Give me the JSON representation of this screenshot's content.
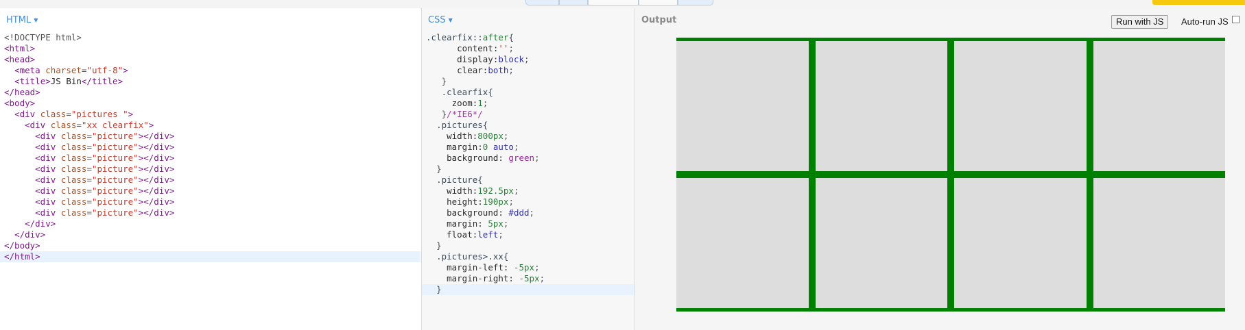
{
  "topbar": {
    "tabs": [
      "",
      "",
      "",
      "",
      ""
    ],
    "cta_label": ""
  },
  "html_panel": {
    "label": "HTML",
    "caret_icon": "caret-down-icon"
  },
  "css_panel": {
    "label": "CSS",
    "caret_icon": "caret-down-icon"
  },
  "output_panel": {
    "label": "Output",
    "run_button_label": "Run with JS",
    "autorun_label": "Auto-run JS",
    "autorun_checked": false
  },
  "html_code": [
    [
      [
        "punct",
        "<!DOCTYPE html>"
      ]
    ],
    [
      [
        "tag",
        "<html>"
      ]
    ],
    [
      [
        "tag",
        "<head>"
      ]
    ],
    [
      [
        "txt",
        "  "
      ],
      [
        "tag",
        "<meta "
      ],
      [
        "attr",
        "charset"
      ],
      [
        "punct",
        "="
      ],
      [
        "str",
        "\"utf-8\""
      ],
      [
        "tag",
        ">"
      ]
    ],
    [
      [
        "txt",
        "  "
      ],
      [
        "tag",
        "<title>"
      ],
      [
        "txt",
        "JS Bin"
      ],
      [
        "tag",
        "</title>"
      ]
    ],
    [
      [
        "tag",
        "</head>"
      ]
    ],
    [
      [
        "tag",
        "<body>"
      ]
    ],
    [
      [
        "txt",
        "  "
      ],
      [
        "tag",
        "<div "
      ],
      [
        "attr",
        "class"
      ],
      [
        "punct",
        "="
      ],
      [
        "str",
        "\"pictures \""
      ],
      [
        "tag",
        ">"
      ]
    ],
    [
      [
        "txt",
        "    "
      ],
      [
        "tag",
        "<div "
      ],
      [
        "attr",
        "class"
      ],
      [
        "punct",
        "="
      ],
      [
        "str",
        "\"xx clearfix\""
      ],
      [
        "tag",
        ">"
      ]
    ],
    [
      [
        "txt",
        "      "
      ],
      [
        "tag",
        "<div "
      ],
      [
        "attr",
        "class"
      ],
      [
        "punct",
        "="
      ],
      [
        "str",
        "\"picture\""
      ],
      [
        "tag",
        "></div>"
      ]
    ],
    [
      [
        "txt",
        "      "
      ],
      [
        "tag",
        "<div "
      ],
      [
        "attr",
        "class"
      ],
      [
        "punct",
        "="
      ],
      [
        "str",
        "\"picture\""
      ],
      [
        "tag",
        "></div>"
      ]
    ],
    [
      [
        "txt",
        "      "
      ],
      [
        "tag",
        "<div "
      ],
      [
        "attr",
        "class"
      ],
      [
        "punct",
        "="
      ],
      [
        "str",
        "\"picture\""
      ],
      [
        "tag",
        "></div>"
      ]
    ],
    [
      [
        "txt",
        "      "
      ],
      [
        "tag",
        "<div "
      ],
      [
        "attr",
        "class"
      ],
      [
        "punct",
        "="
      ],
      [
        "str",
        "\"picture\""
      ],
      [
        "tag",
        "></div>"
      ]
    ],
    [
      [
        "txt",
        "      "
      ],
      [
        "tag",
        "<div "
      ],
      [
        "attr",
        "class"
      ],
      [
        "punct",
        "="
      ],
      [
        "str",
        "\"picture\""
      ],
      [
        "tag",
        "></div>"
      ]
    ],
    [
      [
        "txt",
        "      "
      ],
      [
        "tag",
        "<div "
      ],
      [
        "attr",
        "class"
      ],
      [
        "punct",
        "="
      ],
      [
        "str",
        "\"picture\""
      ],
      [
        "tag",
        "></div>"
      ]
    ],
    [
      [
        "txt",
        "      "
      ],
      [
        "tag",
        "<div "
      ],
      [
        "attr",
        "class"
      ],
      [
        "punct",
        "="
      ],
      [
        "str",
        "\"picture\""
      ],
      [
        "tag",
        "></div>"
      ]
    ],
    [
      [
        "txt",
        "      "
      ],
      [
        "tag",
        "<div "
      ],
      [
        "attr",
        "class"
      ],
      [
        "punct",
        "="
      ],
      [
        "str",
        "\"picture\""
      ],
      [
        "tag",
        "></div>"
      ]
    ],
    [
      [
        "txt",
        "    "
      ],
      [
        "tag",
        "</div>"
      ]
    ],
    [
      [
        "txt",
        "  "
      ],
      [
        "tag",
        "</div>"
      ]
    ],
    [
      [
        "tag",
        "</body>"
      ]
    ],
    [
      [
        "tag",
        "</html>"
      ]
    ]
  ],
  "html_highlight_line": 20,
  "css_code": [
    [
      [
        "sel",
        ".clearfix::"
      ],
      [
        "val",
        "after"
      ],
      [
        "sel",
        "{"
      ]
    ],
    [
      [
        "txt",
        "      "
      ],
      [
        "prop",
        "content:"
      ],
      [
        "str",
        "''"
      ],
      [
        "punct",
        ";"
      ]
    ],
    [
      [
        "txt",
        "      "
      ],
      [
        "prop",
        "display:"
      ],
      [
        "kw",
        "block"
      ],
      [
        "punct",
        ";"
      ]
    ],
    [
      [
        "txt",
        "      "
      ],
      [
        "prop",
        "clear:"
      ],
      [
        "kw",
        "both"
      ],
      [
        "punct",
        ";"
      ]
    ],
    [
      [
        "txt",
        "   "
      ],
      [
        "punct",
        "}"
      ]
    ],
    [
      [
        "txt",
        "   "
      ],
      [
        "sel",
        ".clearfix{"
      ]
    ],
    [
      [
        "txt",
        "     "
      ],
      [
        "prop",
        "zoom:"
      ],
      [
        "val",
        "1"
      ],
      [
        "punct",
        ";"
      ]
    ],
    [
      [
        "txt",
        "   "
      ],
      [
        "punct",
        "}"
      ],
      [
        "cm",
        "/*IE6*/"
      ]
    ],
    [
      [
        "txt",
        "  "
      ],
      [
        "sel",
        ".pictures{"
      ]
    ],
    [
      [
        "txt",
        "    "
      ],
      [
        "prop",
        "width:"
      ],
      [
        "val",
        "800px"
      ],
      [
        "punct",
        ";"
      ]
    ],
    [
      [
        "txt",
        "    "
      ],
      [
        "prop",
        "margin:"
      ],
      [
        "val",
        "0 "
      ],
      [
        "kw",
        "auto"
      ],
      [
        "punct",
        ";"
      ]
    ],
    [
      [
        "txt",
        "    "
      ],
      [
        "prop",
        "background: "
      ],
      [
        "col",
        "green"
      ],
      [
        "punct",
        ";"
      ]
    ],
    [
      [
        "txt",
        "  "
      ],
      [
        "punct",
        "}"
      ]
    ],
    [
      [
        "txt",
        "  "
      ],
      [
        "sel",
        ".picture{"
      ]
    ],
    [
      [
        "txt",
        "    "
      ],
      [
        "prop",
        "width:"
      ],
      [
        "val",
        "192.5px"
      ],
      [
        "punct",
        ";"
      ]
    ],
    [
      [
        "txt",
        "    "
      ],
      [
        "prop",
        "height:"
      ],
      [
        "val",
        "190px"
      ],
      [
        "punct",
        ";"
      ]
    ],
    [
      [
        "txt",
        "    "
      ],
      [
        "prop",
        "background: "
      ],
      [
        "kw",
        "#ddd"
      ],
      [
        "punct",
        ";"
      ]
    ],
    [
      [
        "txt",
        "    "
      ],
      [
        "prop",
        "margin: "
      ],
      [
        "val",
        "5px"
      ],
      [
        "punct",
        ";"
      ]
    ],
    [
      [
        "txt",
        "    "
      ],
      [
        "prop",
        "float:"
      ],
      [
        "kw",
        "left"
      ],
      [
        "punct",
        ";"
      ]
    ],
    [
      [
        "txt",
        "  "
      ],
      [
        "punct",
        "}"
      ]
    ],
    [
      [
        "txt",
        "  "
      ],
      [
        "sel",
        ".pictures>.xx{"
      ]
    ],
    [
      [
        "txt",
        "    "
      ],
      [
        "prop",
        "margin-left: "
      ],
      [
        "val",
        "-5px"
      ],
      [
        "punct",
        ";"
      ]
    ],
    [
      [
        "txt",
        "    "
      ],
      [
        "prop",
        "margin-right: "
      ],
      [
        "val",
        "-5px"
      ],
      [
        "punct",
        ";"
      ]
    ],
    [
      [
        "txt",
        "  "
      ],
      [
        "punct",
        "}"
      ]
    ]
  ],
  "css_highlight_line": 23,
  "output": {
    "container_color": "#008000",
    "picture_color": "#dddddd",
    "picture_count": 8
  }
}
